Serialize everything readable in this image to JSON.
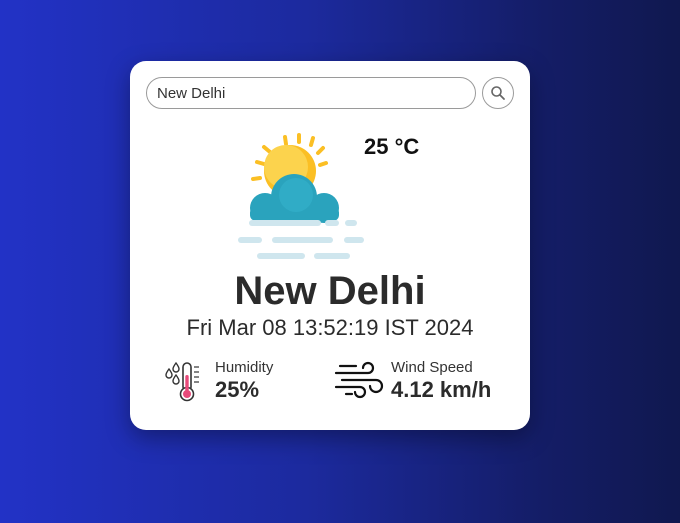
{
  "search": {
    "value": "New Delhi",
    "button_icon": "search-icon"
  },
  "weather": {
    "icon": "sun-cloud-mist-icon",
    "temperature": "25 °C",
    "city": "New Delhi",
    "datetime": "Fri Mar 08 13:52:19 IST 2024"
  },
  "stats": {
    "humidity": {
      "icon": "humidity-thermometer-icon",
      "label": "Humidity",
      "value": "25%"
    },
    "wind": {
      "icon": "wind-icon",
      "label": "Wind Speed",
      "value": "4.12 km/h"
    }
  },
  "colors": {
    "background_start": "#2232c6",
    "background_end": "#10184f",
    "card": "#ffffff",
    "sun": "#fbbf24",
    "cloud": "#2aa3bd",
    "mist": "#cfe6ee"
  }
}
